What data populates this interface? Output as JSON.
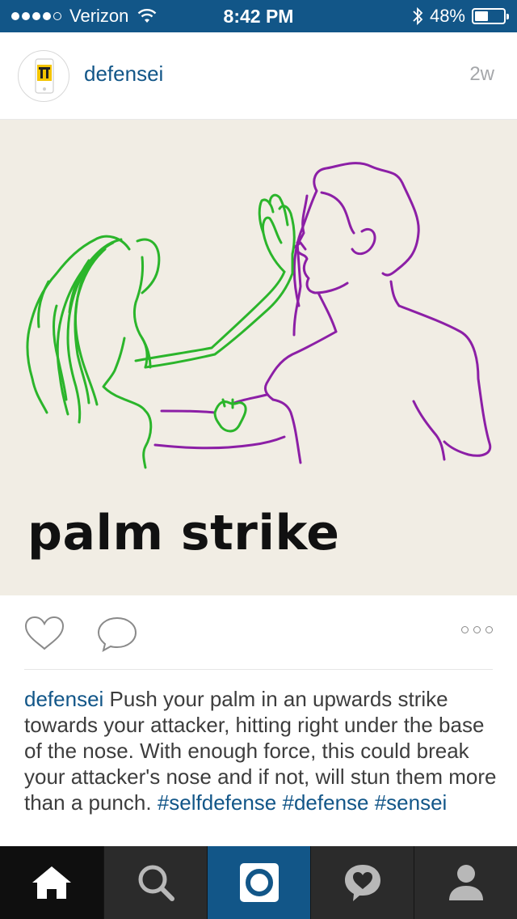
{
  "status_bar": {
    "carrier": "Verizon",
    "signal_bars_filled": 4,
    "signal_bars_total": 5,
    "time": "8:42 PM",
    "battery_percent": "48%",
    "battery_level": 0.48
  },
  "post": {
    "username": "defensei",
    "time_ago": "2w",
    "image_caption": "palm strike",
    "caption_user": "defensei",
    "caption_text": "Push your palm in an upwards strike towards your attacker, hitting right under the base of the nose. With enough force, this could break your attacker's nose and if not, will stun them more than a punch.",
    "hashtags": [
      "#selfdefense",
      "#defense",
      "#sensei"
    ]
  },
  "icons": {
    "like": "heart-icon",
    "comment": "comment-bubble-icon",
    "more": "more-options-icon",
    "home": "home-icon",
    "search": "search-icon",
    "camera": "camera-icon",
    "activity": "activity-heart-icon",
    "profile": "profile-icon"
  },
  "colors": {
    "brand_blue": "#125688",
    "image_background": "#f1ede4",
    "figure_green": "#2bb52b",
    "figure_purple": "#8c1fa6",
    "tab_bar": "#1a1a1a"
  }
}
